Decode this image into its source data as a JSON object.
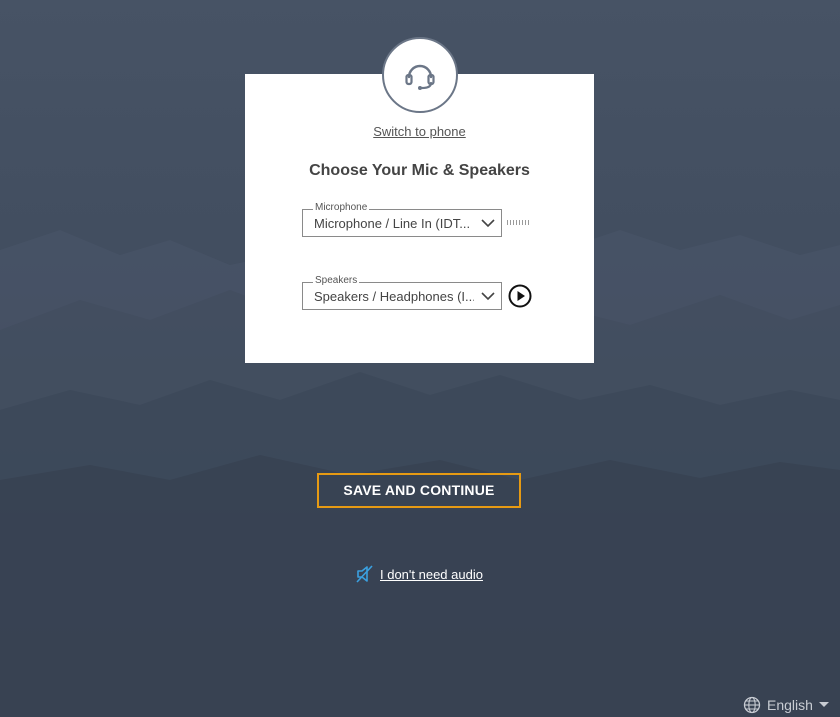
{
  "dialog": {
    "switch_link": "Switch to phone",
    "title": "Choose Your Mic & Speakers",
    "microphone": {
      "legend": "Microphone",
      "value": "Microphone / Line In (IDT..."
    },
    "speakers": {
      "legend": "Speakers",
      "value": "Speakers / Headphones (I..."
    }
  },
  "actions": {
    "save_label": "SAVE AND CONTINUE",
    "no_audio_label": "I don't need audio"
  },
  "footer": {
    "language": "English"
  },
  "colors": {
    "accent": "#e69a13",
    "link_blue": "#3aa0e0",
    "background": "#414d5f"
  },
  "icons": {
    "avatar": "headset-icon",
    "mic_dropdown": "chevron-down-icon",
    "speaker_dropdown": "chevron-down-icon",
    "test_speaker": "play-icon",
    "no_audio": "speaker-muted-icon",
    "language": "globe-icon",
    "language_dropdown": "caret-down-icon"
  }
}
